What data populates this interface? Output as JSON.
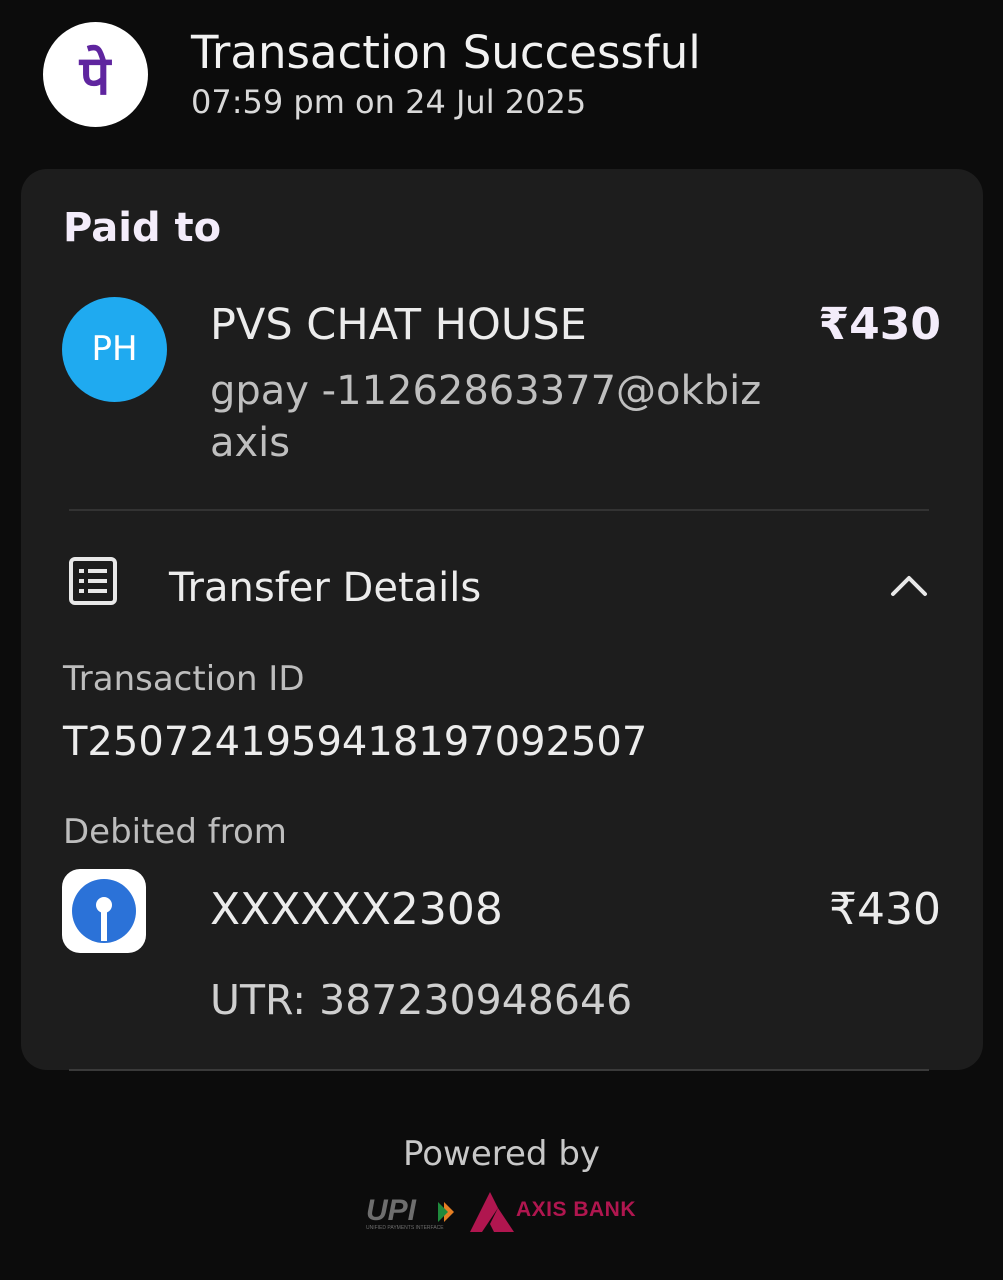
{
  "header": {
    "app_logo_glyph": "पे",
    "app_logo_color": "#5f259f",
    "title": "Transaction Successful",
    "timestamp": "07:59 pm on 24 Jul 2025"
  },
  "card": {
    "paid_to_label": "Paid to",
    "payee": {
      "avatar_initials": "PH",
      "avatar_color": "#1faaf0",
      "name": "PVS CHAT HOUSE",
      "upi_id": "gpay -11262863377@okbizaxis",
      "amount": "₹430"
    },
    "transfer_details": {
      "label": "Transfer Details",
      "icon": "receipt-list-icon",
      "toggle_icon": "chevron-up-icon",
      "transaction_id_label": "Transaction ID",
      "transaction_id": "T2507241959418197092507",
      "debited_from_label": "Debited from",
      "bank_icon": "sbi-bank-logo",
      "account": "XXXXXX2308",
      "amount": "₹430",
      "utr": "UTR: 387230948646"
    }
  },
  "footer": {
    "powered_by": "Powered by",
    "upi_logo_text": "UPI",
    "upi_logo_subtext": "UNIFIED PAYMENTS INTERFACE",
    "bank_name": "AXIS BANK",
    "bank_color": "#b0164f"
  }
}
